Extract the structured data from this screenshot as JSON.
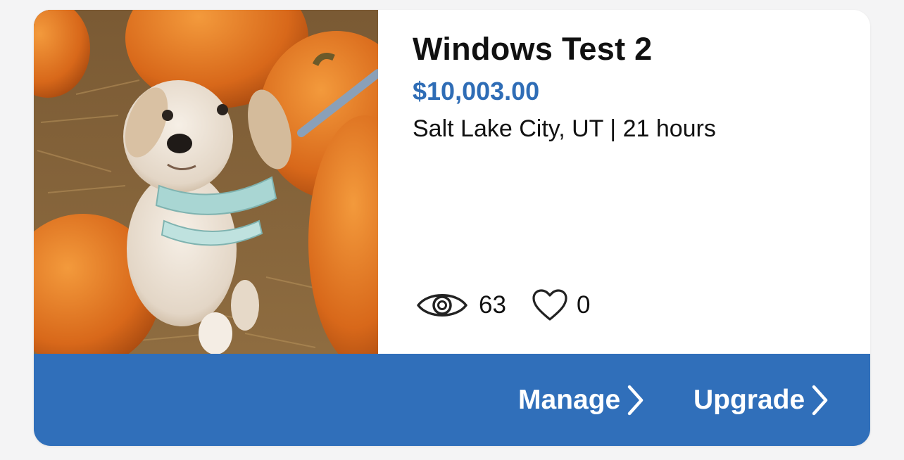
{
  "listing": {
    "title": "Windows Test 2",
    "price": "$10,003.00",
    "meta": "Salt Lake City, UT | 21 hours",
    "photo_icon": "listing-photo-dog-with-pumpkins",
    "views": "63",
    "favorites": "0",
    "views_icon": "eye-icon",
    "favorites_icon": "heart-icon"
  },
  "actions": {
    "manage_label": "Manage",
    "upgrade_label": "Upgrade",
    "chevron_icon": "chevron-right-icon"
  },
  "colors": {
    "accent": "#306fba",
    "price": "#2f6db6",
    "text": "#111111",
    "background": "#f4f4f5",
    "card": "#ffffff"
  }
}
